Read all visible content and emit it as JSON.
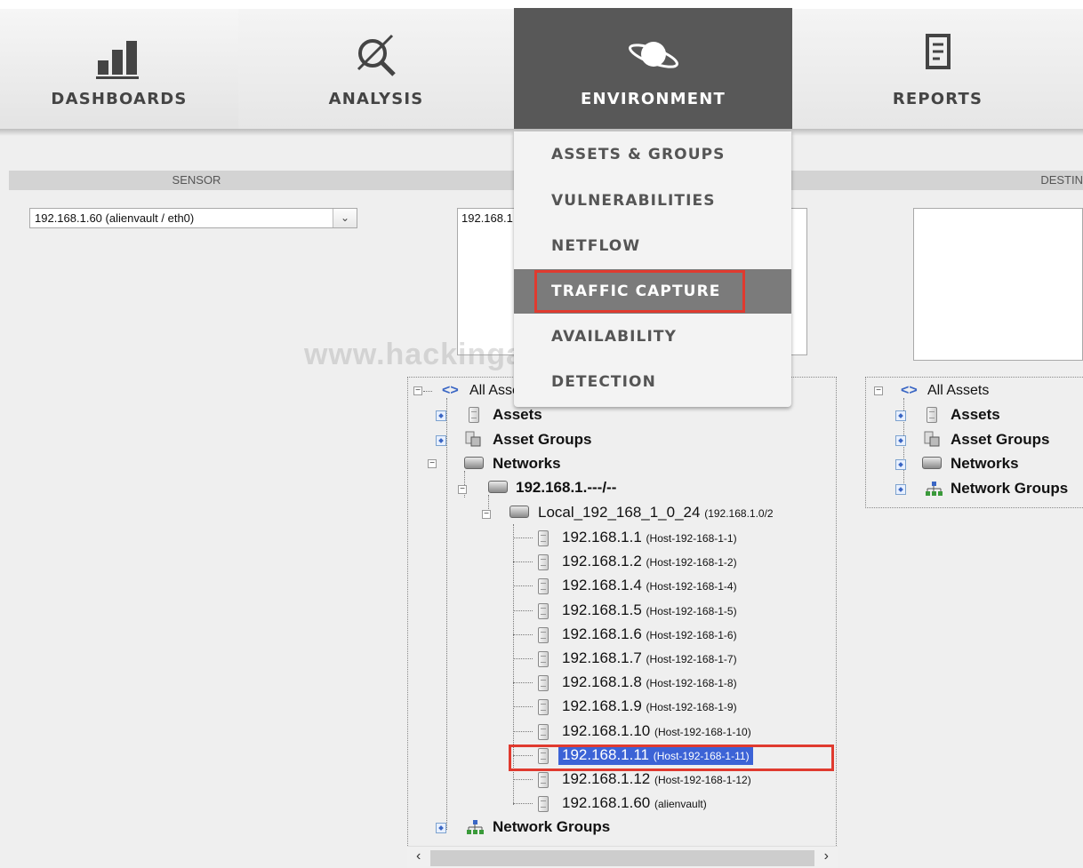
{
  "nav": {
    "items": [
      {
        "label": "DASHBOARDS",
        "icon": "bar-chart-icon"
      },
      {
        "label": "ANALYSIS",
        "icon": "analysis-icon"
      },
      {
        "label": "ENVIRONMENT",
        "icon": "planet-icon"
      },
      {
        "label": "REPORTS",
        "icon": "report-icon"
      }
    ],
    "active": "ENVIRONMENT"
  },
  "env_menu": {
    "items": [
      "ASSETS & GROUPS",
      "VULNERABILITIES",
      "NETFLOW",
      "TRAFFIC CAPTURE",
      "AVAILABILITY",
      "DETECTION"
    ],
    "highlighted": "TRAFFIC CAPTURE"
  },
  "sections": {
    "sensor": "SENSOR",
    "destination": "DESTIN"
  },
  "sensor_select": {
    "value": "192.168.1.60 (alienvault / eth0)"
  },
  "source_box": {
    "value": "192.168.1.11"
  },
  "watermark": "www.hackingarticles.in",
  "source_tree": {
    "root": "All Assets",
    "assets": "Assets",
    "asset_groups": "Asset Groups",
    "networks": "Networks",
    "net_group": "192.168.1.---/--",
    "local_net": "Local_192_168_1_0_24",
    "local_net_cidr": "(192.168.1.0/2",
    "hosts": [
      {
        "ip": "192.168.1.1",
        "name": "(Host-192-168-1-1)"
      },
      {
        "ip": "192.168.1.2",
        "name": "(Host-192-168-1-2)"
      },
      {
        "ip": "192.168.1.4",
        "name": "(Host-192-168-1-4)"
      },
      {
        "ip": "192.168.1.5",
        "name": "(Host-192-168-1-5)"
      },
      {
        "ip": "192.168.1.6",
        "name": "(Host-192-168-1-6)"
      },
      {
        "ip": "192.168.1.7",
        "name": "(Host-192-168-1-7)"
      },
      {
        "ip": "192.168.1.8",
        "name": "(Host-192-168-1-8)"
      },
      {
        "ip": "192.168.1.9",
        "name": "(Host-192-168-1-9)"
      },
      {
        "ip": "192.168.1.10",
        "name": "(Host-192-168-1-10)"
      },
      {
        "ip": "192.168.1.11",
        "name": "(Host-192-168-1-11)"
      },
      {
        "ip": "192.168.1.12",
        "name": "(Host-192-168-1-12)"
      },
      {
        "ip": "192.168.1.60",
        "name": "(alienvault)"
      }
    ],
    "selected_ip": "192.168.1.11",
    "network_groups": "Network Groups"
  },
  "dest_tree": {
    "root": "All Assets",
    "assets": "Assets",
    "asset_groups": "Asset Groups",
    "networks": "Networks",
    "network_groups": "Network Groups"
  },
  "colors": {
    "selection": "#3c63d6",
    "highlight_box": "#e03a2f",
    "active_tab": "#585858"
  }
}
